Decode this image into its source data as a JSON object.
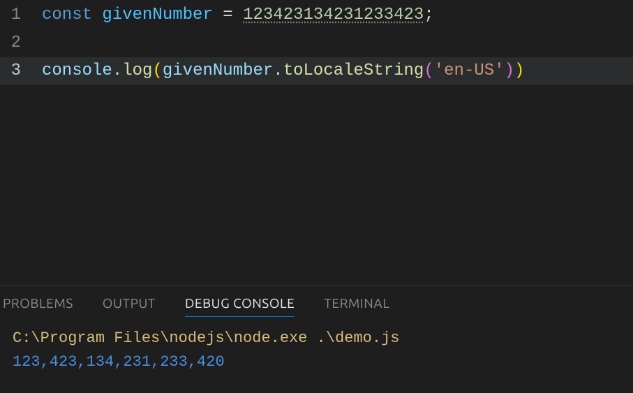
{
  "editor": {
    "lines": [
      {
        "num": "1"
      },
      {
        "num": "2"
      },
      {
        "num": "3"
      }
    ],
    "tokens": {
      "l1_kw": "const",
      "l1_var": "givenNumber",
      "l1_eq": " = ",
      "l1_num": "123423134231233423",
      "l1_semi": ";",
      "l3_obj": "console",
      "l3_dot1": ".",
      "l3_fn1": "log",
      "l3_open1": "(",
      "l3_var": "givenNumber",
      "l3_dot2": ".",
      "l3_fn2": "toLocaleString",
      "l3_open2": "(",
      "l3_str": "'en-US'",
      "l3_close2": ")",
      "l3_close1": ")"
    }
  },
  "panel": {
    "tabs": {
      "problems": "PROBLEMS",
      "output": "OUTPUT",
      "debug_console": "DEBUG CONSOLE",
      "terminal": "TERMINAL"
    },
    "output": {
      "command": "C:\\Program Files\\nodejs\\node.exe .\\demo.js",
      "result": "123,423,134,231,233,420"
    }
  }
}
